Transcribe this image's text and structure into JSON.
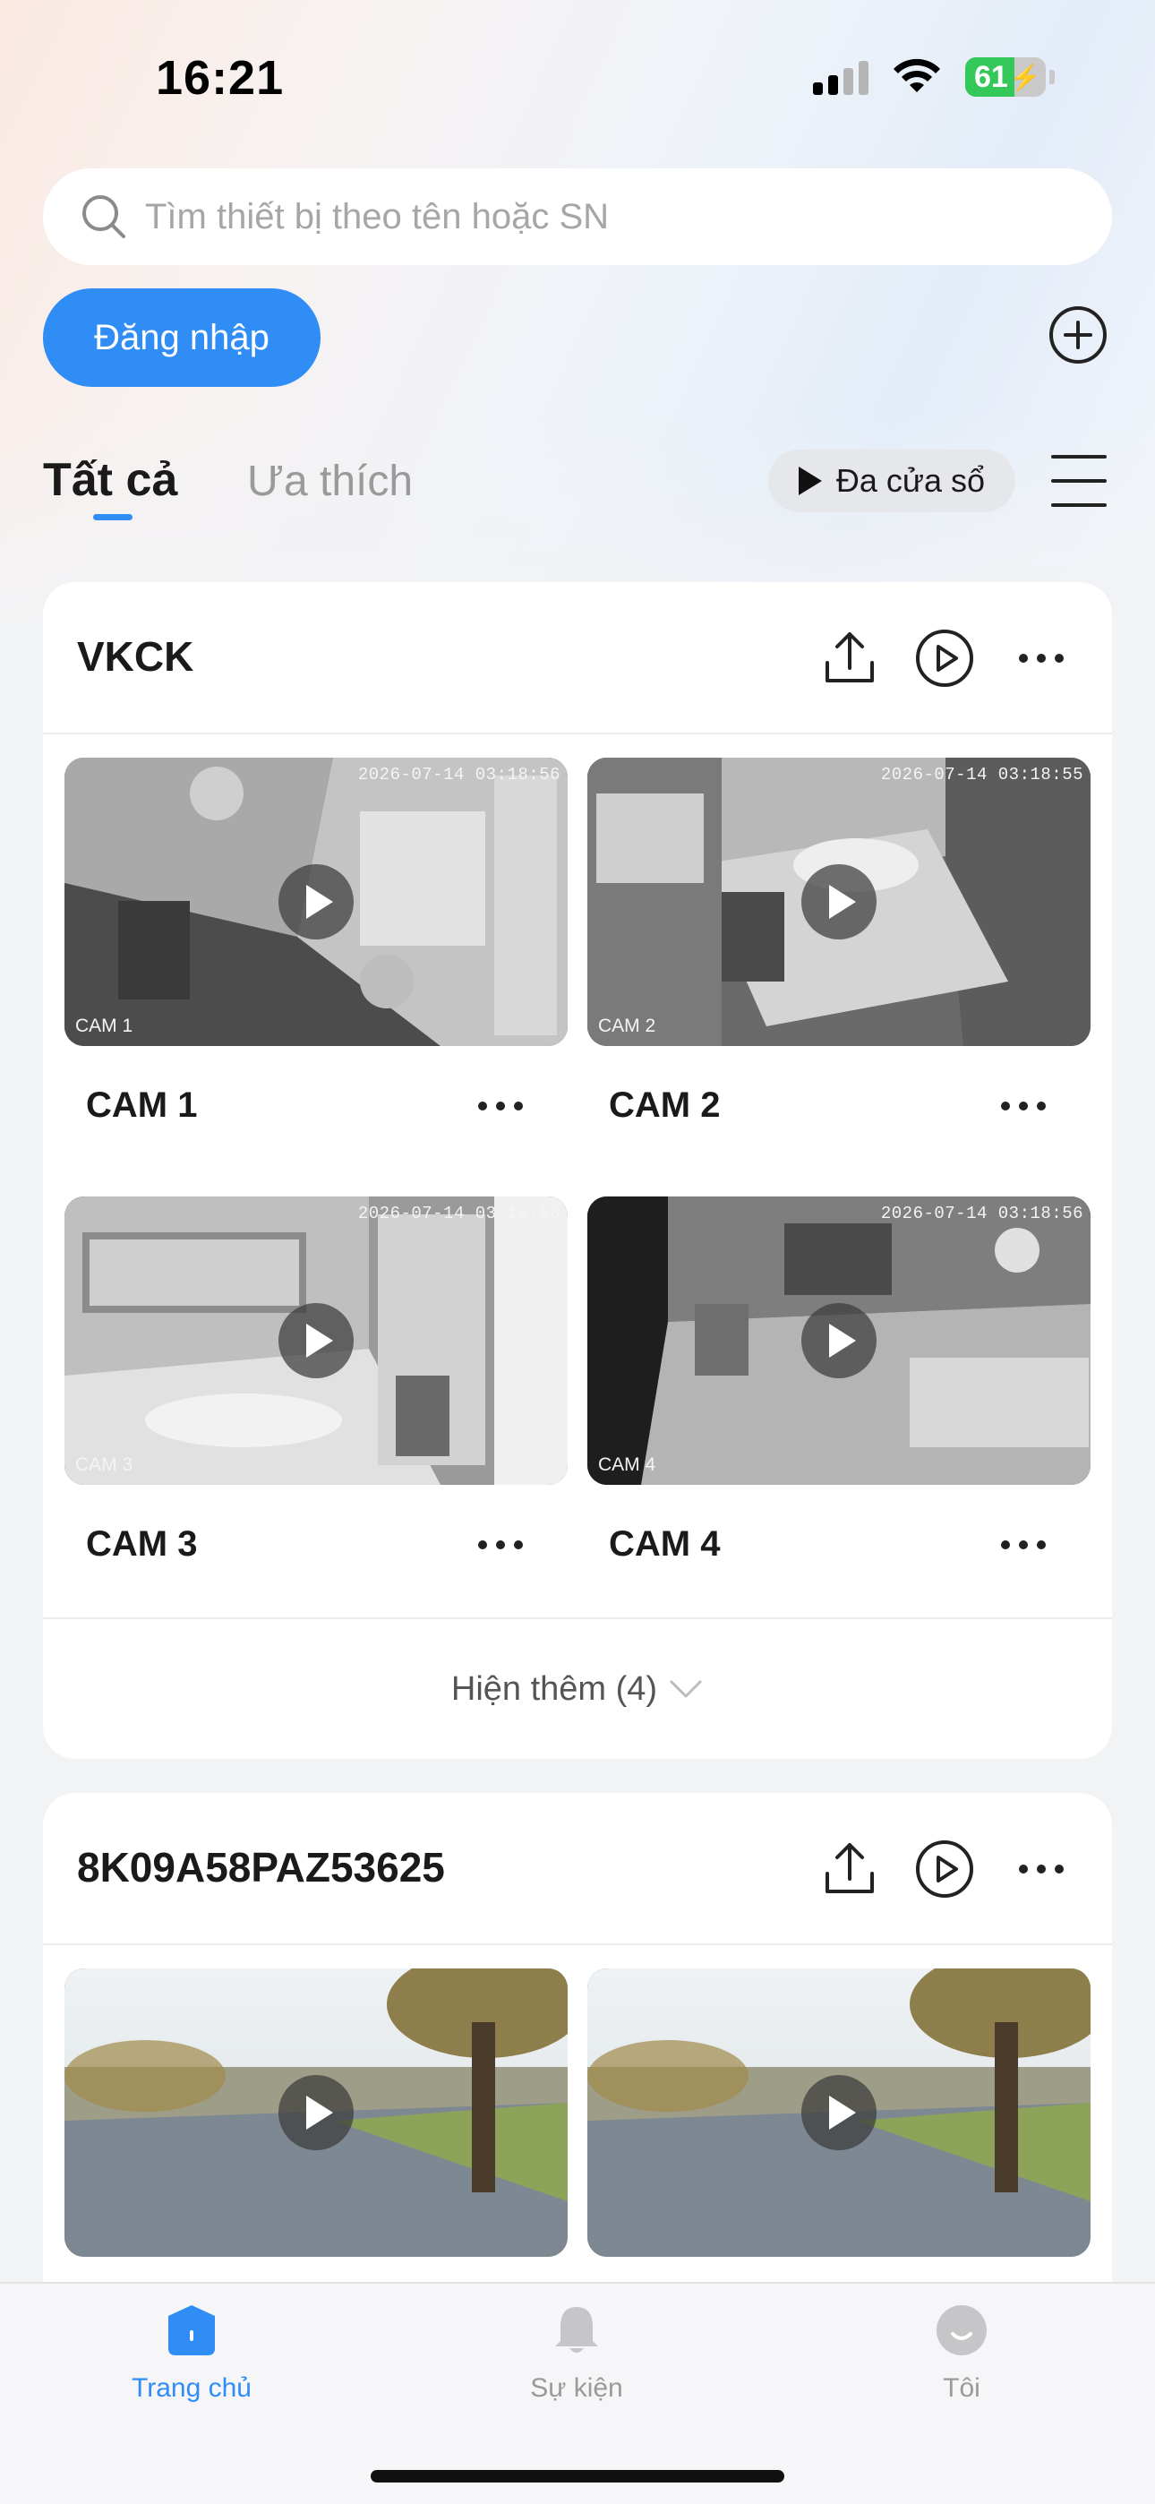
{
  "status_bar": {
    "time": "16:21",
    "battery": "61"
  },
  "search": {
    "placeholder": "Tìm thiết bị theo tên hoặc SN"
  },
  "login_button": "Đăng nhập",
  "tabs": {
    "all": "Tất cả",
    "favorites": "Ưa thích"
  },
  "multi_window": "Đa cửa sổ",
  "devices": [
    {
      "name": "VKCK",
      "cameras": [
        {
          "name": "CAM 1",
          "label": "CAM 1",
          "timestamp": "2026-07-14 03:18:56"
        },
        {
          "name": "CAM 2",
          "label": "CAM 2",
          "timestamp": "2026-07-14 03:18:55"
        },
        {
          "name": "CAM 3",
          "label": "CAM 3",
          "timestamp": "2026-07-14 03:18:56"
        },
        {
          "name": "CAM 4",
          "label": "CAM 4",
          "timestamp": "2026-07-14 03:18:56"
        }
      ],
      "show_more": "Hiện thêm (4)"
    },
    {
      "name": "8K09A58PAZ53625"
    }
  ],
  "bottom_nav": {
    "home": "Trang chủ",
    "events": "Sự kiện",
    "me": "Tôi"
  },
  "colors": {
    "accent": "#2f8df5",
    "battery": "#34c759"
  },
  "icons": [
    "search-icon",
    "add-circle-icon",
    "play-icon",
    "hamburger-menu-icon",
    "upload-icon",
    "play-circle-icon",
    "more-dots-icon",
    "chevron-down-icon",
    "home-icon",
    "bell-icon",
    "profile-icon"
  ]
}
